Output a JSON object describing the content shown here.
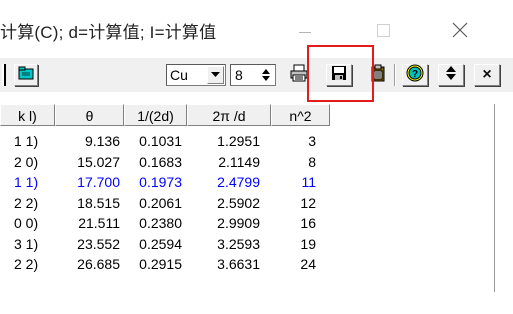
{
  "window": {
    "title": "计算(C); d=计算值; I=计算值",
    "controls": {
      "minimize_icon": "minimize-icon",
      "maximize_icon": "maximize-icon",
      "close_icon": "close-icon"
    }
  },
  "toolbar": {
    "element_combo": {
      "value": "Cu"
    },
    "spin_field": {
      "value": "8"
    },
    "buttons": [
      "folder-icon",
      "printer-icon",
      "save-icon",
      "clipboard-icon",
      "help-icon",
      "sort-icon",
      "close-x"
    ],
    "close_label": "×",
    "highlight_color": "#e31b1b"
  },
  "table": {
    "columns": [
      "k l)",
      "θ",
      "1/(2d)",
      "2π /d",
      "n^2"
    ],
    "selected_color": "#0000ff",
    "rows": [
      [
        "1 1)",
        "9.136",
        "0.1031",
        "1.2951",
        "3"
      ],
      [
        "2 0)",
        "15.027",
        "0.1683",
        "2.1149",
        "8"
      ],
      [
        "1 1)",
        "17.700",
        "0.1973",
        "2.4799",
        "11"
      ],
      [
        "2 2)",
        "18.515",
        "0.2061",
        "2.5902",
        "12"
      ],
      [
        "0 0)",
        "21.511",
        "0.2380",
        "2.9909",
        "16"
      ],
      [
        "3 1)",
        "23.552",
        "0.2594",
        "3.2593",
        "19"
      ],
      [
        "2 2)",
        "26.685",
        "0.2915",
        "3.6631",
        "24"
      ]
    ],
    "selected_row": 2
  }
}
